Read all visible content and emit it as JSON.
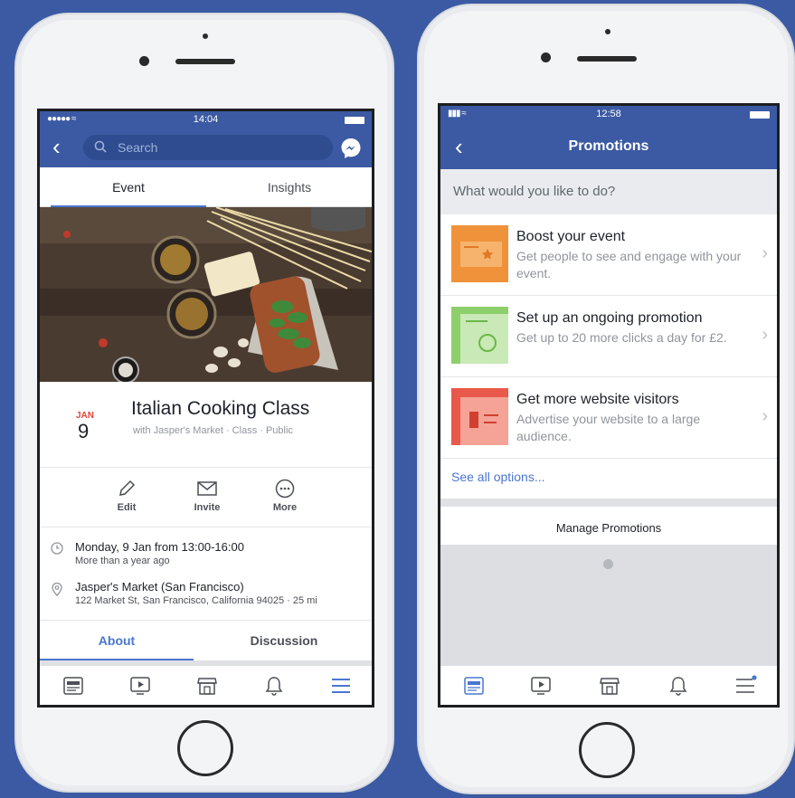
{
  "phone1": {
    "status": {
      "time": "14:04"
    },
    "search_placeholder": "Search",
    "tabs": [
      "Event",
      "Insights"
    ],
    "event": {
      "month": "JAN",
      "day": "9",
      "title": "Italian Cooking Class",
      "subtitle": "with Jasper's Market · Class · Public"
    },
    "actions": [
      {
        "label": "Edit",
        "icon": "pencil-icon"
      },
      {
        "label": "Invite",
        "icon": "envelope-icon"
      },
      {
        "label": "More",
        "icon": "more-icon"
      }
    ],
    "details": {
      "time_line1": "Monday, 9 Jan from 13:00-16:00",
      "time_line2": "More than a year ago",
      "place_line1": "Jasper's Market (San Francisco)",
      "place_line2": "122 Market St, San Francisco, California 94025 · 25 mi"
    },
    "bottom_tabs": [
      "About",
      "Discussion"
    ],
    "accent": "#4a76d0",
    "brand": "#3b5aa3"
  },
  "phone2": {
    "status": {
      "time": "12:58"
    },
    "title": "Promotions",
    "question": "What would you like to do?",
    "options": [
      {
        "title": "Boost your event",
        "desc": "Get people to see and engage with your event.",
        "thumb_color": "#f0923a"
      },
      {
        "title": "Set up an ongoing promotion",
        "desc": "Get up to 20 more clicks a day for £2.",
        "thumb_color": "#8ccf6b"
      },
      {
        "title": "Get more website visitors",
        "desc": "Advertise your website to a large audience.",
        "thumb_color": "#e8594a"
      }
    ],
    "see_all": "See all options...",
    "manage": "Manage Promotions"
  }
}
